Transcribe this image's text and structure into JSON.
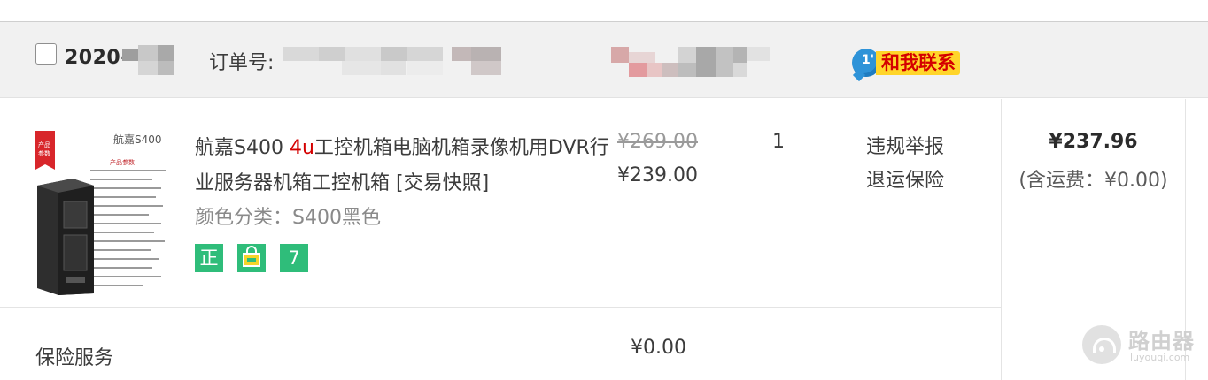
{
  "order": {
    "date_prefix": "2020-",
    "order_no_label": "订单号:",
    "contact_seller": {
      "label": "和我联系",
      "bubble_mark": "1'",
      "icon": "chat-bubble-icon"
    }
  },
  "item": {
    "title_prefix": "航嘉S400 ",
    "title_highlight": "4u",
    "title_suffix": "工控机箱电脑机箱录像机用DVR行业服务器机箱工控机箱 [交易快照]",
    "sku_attr": "颜色分类：S400黑色",
    "badges": [
      {
        "text": "正",
        "icon": "genuine-badge-icon"
      },
      {
        "text": "",
        "icon": "shopping-bag-badge-icon"
      },
      {
        "text": "7",
        "icon": "seven-day-return-badge-icon"
      }
    ],
    "price_original": "¥269.00",
    "price_current": "¥239.00",
    "quantity": "1",
    "operations": {
      "report": "违规举报",
      "return_insurance": "退运保险"
    },
    "thumbnail": {
      "brand_text": "航嘉S400",
      "tag_text": "产品参数"
    }
  },
  "summary": {
    "total": "¥237.96",
    "shipping": "(含运费：¥0.00)"
  },
  "insurance": {
    "label": "保险服务",
    "price": "¥0.00"
  },
  "watermark": {
    "title": "路由器",
    "subtitle": "luyouqi.com"
  },
  "colors": {
    "accent_red": "#d40000",
    "badge_green": "#2fbd7a",
    "contact_yellow": "#ffd52a",
    "bubble_blue": "#2e93d8",
    "header_bg": "#f1f1f1"
  }
}
